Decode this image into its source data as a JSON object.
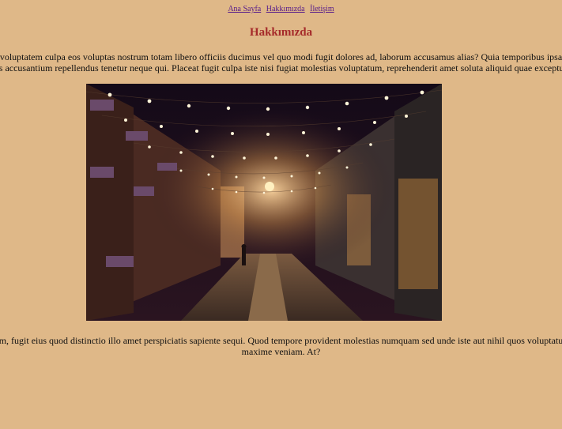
{
  "nav": {
    "links": [
      "Ana Sayfa",
      "Hakkımızda",
      "İletişim"
    ]
  },
  "page": {
    "title": "Hakkımızda"
  },
  "content": {
    "paragraph_1_line_1": "voluptatem culpa eos voluptas nostrum totam libero officiis ducimus vel quo modi fugit dolores ad, laborum accusamus alias? Quia temporibus ipsa",
    "paragraph_1_line_2": "tes accusantium repellendus tenetur neque qui. Placeat fugit culpa iste nisi fugiat molestias voluptatum, reprehenderit amet soluta aliquid quae excepturi",
    "paragraph_2_line_1": "ium, fugit eius quod distinctio illo amet perspiciatis sapiente sequi. Quod tempore provident molestias numquam sed unde iste aut nihil quos voluptatum",
    "paragraph_2_line_2": "maxime veniam. At?"
  },
  "colors": {
    "background": "#DFB888",
    "title": "#A52A2A",
    "link": "#551A8B"
  }
}
